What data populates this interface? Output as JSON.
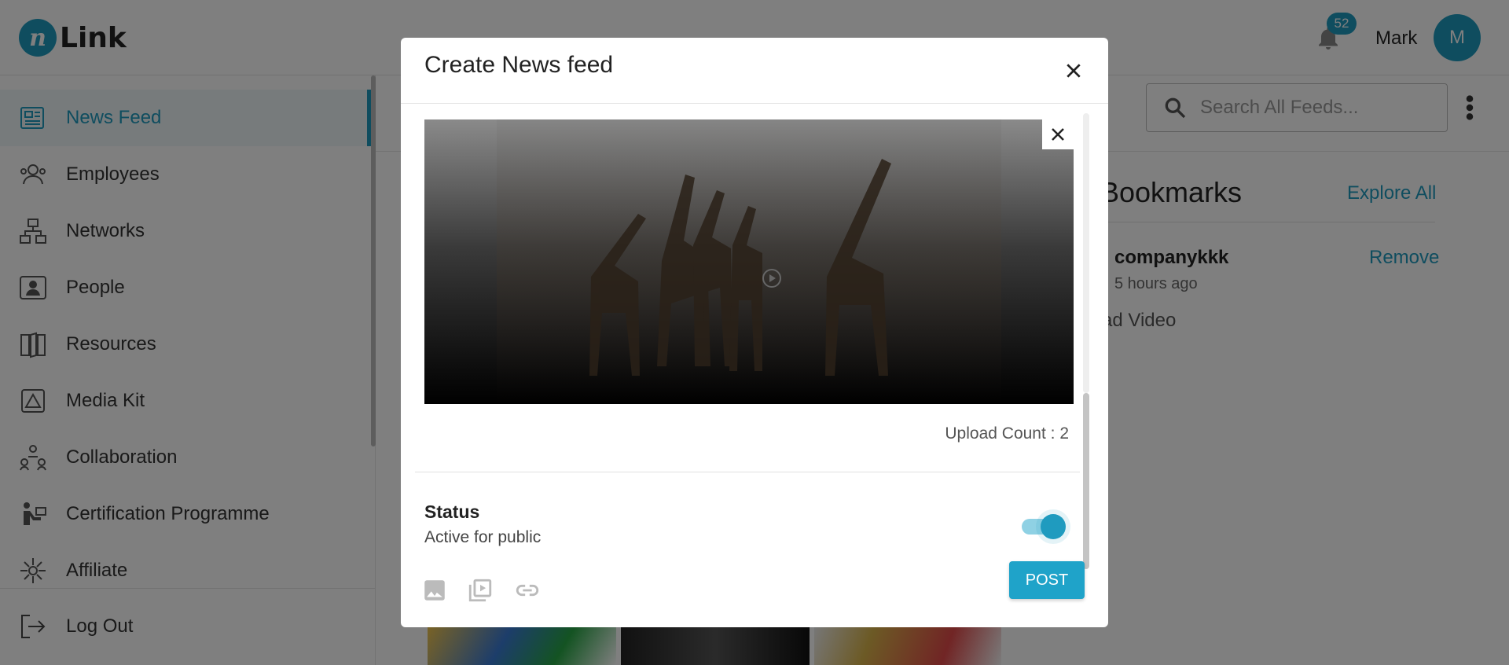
{
  "app": {
    "logo_letter": "n",
    "logo_text": "Link"
  },
  "header": {
    "notification_count": "52",
    "user_name": "Mark",
    "avatar_initial": "M"
  },
  "sidebar": {
    "items": [
      {
        "label": "News Feed",
        "icon": "newspaper-icon"
      },
      {
        "label": "Employees",
        "icon": "employees-icon"
      },
      {
        "label": "Networks",
        "icon": "network-icon"
      },
      {
        "label": "People",
        "icon": "people-icon"
      },
      {
        "label": "Resources",
        "icon": "book-icon"
      },
      {
        "label": "Media Kit",
        "icon": "media-kit-icon"
      },
      {
        "label": "Collaboration",
        "icon": "collaboration-icon"
      },
      {
        "label": "Certification Programme",
        "icon": "certification-icon"
      },
      {
        "label": "Affiliate",
        "icon": "affiliate-icon"
      }
    ],
    "logout_label": "Log Out"
  },
  "search": {
    "placeholder": "Search All Feeds..."
  },
  "bookmarks": {
    "title": "Bookmarks",
    "explore_label": "Explore All",
    "item": {
      "company": "companykkk",
      "remove_label": "Remove",
      "time": "5 hours ago",
      "type": "ad Video"
    }
  },
  "modal": {
    "title": "Create News feed",
    "upload_count": "Upload Count : 2",
    "status_title": "Status",
    "status_subtitle": "Active for public",
    "status_active": true,
    "post_label": "POST"
  },
  "colors": {
    "accent": "#1f9bbf",
    "post_button": "#1fa3c9"
  }
}
